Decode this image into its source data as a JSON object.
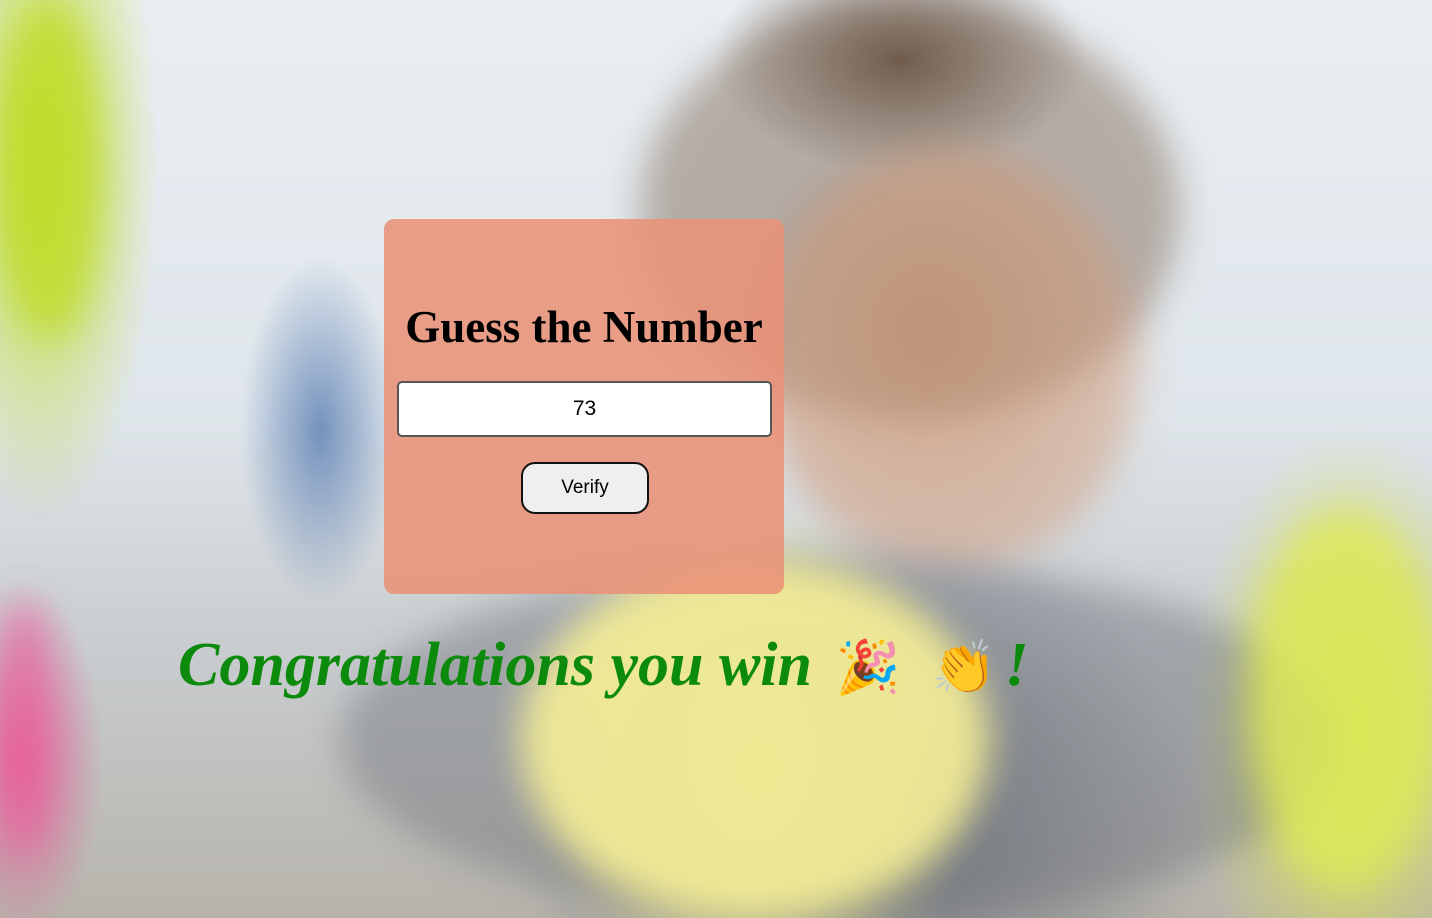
{
  "game": {
    "title": "Guess the Number",
    "input_value": "73",
    "verify_label": "Verify",
    "result_text": "Congratulations you win",
    "result_emoji_party": "🎉",
    "result_emoji_clap": "👏",
    "result_suffix": "!"
  },
  "colors": {
    "card": "#E9927A",
    "success_text": "#0B8A0B"
  }
}
